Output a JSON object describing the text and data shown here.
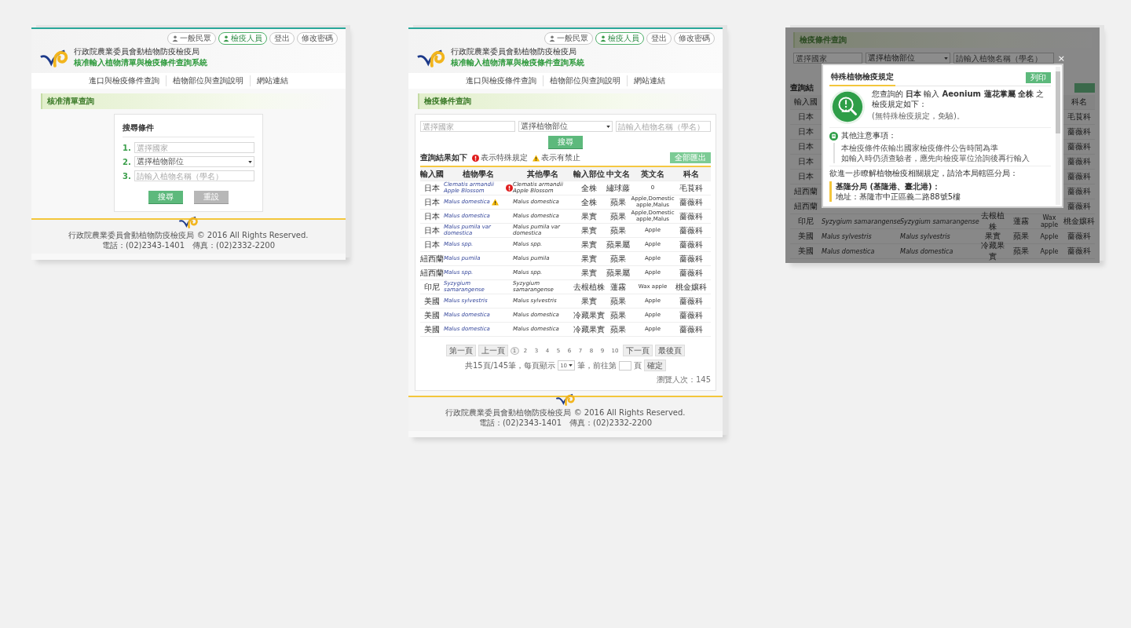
{
  "screens": [
    {
      "kind": "search",
      "header": {
        "top_links": [
          {
            "label": "一般民眾",
            "kind": "user",
            "selected": false
          },
          {
            "label": "檢疫人員",
            "kind": "user",
            "selected": true
          },
          {
            "label": "登出",
            "kind": "plain",
            "selected": false
          },
          {
            "label": "修改密碼",
            "kind": "plain",
            "selected": false
          }
        ],
        "org": "行政院農業委員會動植物防疫檢疫局",
        "system": "核准輸入植物清單與檢疫條件查詢系統"
      },
      "nav": [
        "進口與檢疫條件查詢",
        "植物部位與查詢說明",
        "網站連結"
      ],
      "heading": "核准清單查詢",
      "card_title": "搜尋條件",
      "fields": [
        {
          "number": "1.",
          "kind": "input",
          "placeholder": "選擇國家"
        },
        {
          "number": "2.",
          "kind": "select",
          "value": "選擇植物部位"
        },
        {
          "number": "3.",
          "kind": "input",
          "placeholder": "請輸入植物名稱（學名）"
        }
      ],
      "buttons": [
        {
          "label": "搜尋",
          "kind": "primary"
        },
        {
          "label": "重設",
          "kind": "secondary"
        }
      ],
      "footer": {
        "copyright": "行政院農業委員會動植物防疫檢疫局 © 2016 All Rights Reserved.",
        "contact": "電話：(02)2343-1401　傳真：(02)2332-2200"
      }
    },
    {
      "kind": "results",
      "header": {
        "top_links": [
          {
            "label": "一般民眾",
            "kind": "user",
            "selected": false
          },
          {
            "label": "檢疫人員",
            "kind": "user",
            "selected": true
          },
          {
            "label": "登出",
            "kind": "plain",
            "selected": false
          },
          {
            "label": "修改密碼",
            "kind": "plain",
            "selected": false
          }
        ],
        "org": "行政院農業委員會動植物防疫檢疫局",
        "system": "核准輸入植物清單與檢疫條件查詢系統"
      },
      "nav": [
        "進口與檢疫條件查詢",
        "植物部位與查詢說明",
        "網站連結"
      ],
      "heading": "檢疫條件查詢",
      "fields": [
        {
          "kind": "input",
          "placeholder": "選擇國家"
        },
        {
          "kind": "select",
          "value": "選擇植物部位"
        },
        {
          "kind": "input",
          "placeholder": "請輸入植物名稱（學名）"
        }
      ],
      "search_button": "搜尋",
      "results_title": "查詢結果如下",
      "legend": [
        {
          "kind": "special",
          "label": "表示特殊規定"
        },
        {
          "kind": "warning",
          "label": "表示有禁止"
        }
      ],
      "export_button": "全部匯出",
      "columns": [
        "輸入國",
        "植物學名",
        "其他學名",
        "輸入部位",
        "中文名",
        "英文名",
        "科名"
      ],
      "rows": [
        {
          "country": "日本",
          "scientific": "Clematis armandii Apple Blossom",
          "kind": "special",
          "other": "Clematis armandii Apple Blossom",
          "part": "全株",
          "chinese": "繡球藤",
          "english": "0",
          "family": "毛茛科"
        },
        {
          "country": "日本",
          "scientific": "Malus domestica",
          "kind": "warning",
          "other": "Malus domestica",
          "part": "全株",
          "chinese": "蘋果",
          "english": "Apple,Domestic apple,Malus",
          "family": "薔薇科"
        },
        {
          "country": "日本",
          "scientific": "Malus domestica",
          "kind": "plain",
          "other": "Malus domestica",
          "part": "果實",
          "chinese": "蘋果",
          "english": "Apple,Domestic apple,Malus",
          "family": "薔薇科"
        },
        {
          "country": "日本",
          "scientific": "Malus pumila var domestica",
          "kind": "plain",
          "other": "Malus pumila var domestica",
          "part": "果實",
          "chinese": "蘋果",
          "english": "Apple",
          "family": "薔薇科"
        },
        {
          "country": "日本",
          "scientific": "Malus spp.",
          "kind": "plain",
          "other": "Malus spp.",
          "part": "果實",
          "chinese": "蘋果屬",
          "english": "Apple",
          "family": "薔薇科"
        },
        {
          "country": "紐西蘭",
          "scientific": "Malus pumila",
          "kind": "plain",
          "other": "Malus pumila",
          "part": "果實",
          "chinese": "蘋果",
          "english": "Apple",
          "family": "薔薇科"
        },
        {
          "country": "紐西蘭",
          "scientific": "Malus spp.",
          "kind": "plain",
          "other": "Malus spp.",
          "part": "果實",
          "chinese": "蘋果屬",
          "english": "Apple",
          "family": "薔薇科"
        },
        {
          "country": "印尼",
          "scientific": "Syzygium samarangense",
          "kind": "plain",
          "other": "Syzygium samarangense",
          "part": "去根植株",
          "chinese": "蓮霧",
          "english": "Wax apple",
          "family": "桃金孃科"
        },
        {
          "country": "美國",
          "scientific": "Malus sylvestris",
          "kind": "plain",
          "other": "Malus sylvestris",
          "part": "果實",
          "chinese": "蘋果",
          "english": "Apple",
          "family": "薔薇科"
        },
        {
          "country": "美國",
          "scientific": "Malus domestica",
          "kind": "plain",
          "other": "Malus domestica",
          "part": "冷藏果實",
          "chinese": "蘋果",
          "english": "Apple",
          "family": "薔薇科"
        },
        {
          "country": "美國",
          "scientific": "Malus domestica",
          "kind": "plain",
          "other": "Malus domestica",
          "part": "冷藏果實",
          "chinese": "蘋果",
          "english": "Apple",
          "family": "薔薇科"
        }
      ],
      "pager": {
        "first": "第一頁",
        "prev": "上一頁",
        "pages": [
          {
            "label": "1",
            "selected": true
          },
          {
            "label": "2",
            "selected": false
          },
          {
            "label": "3",
            "selected": false
          },
          {
            "label": "4",
            "selected": false
          },
          {
            "label": "5",
            "selected": false
          },
          {
            "label": "6",
            "selected": false
          },
          {
            "label": "7",
            "selected": false
          },
          {
            "label": "8",
            "selected": false
          },
          {
            "label": "9",
            "selected": false
          },
          {
            "label": "10",
            "selected": false
          }
        ],
        "next": "下一頁",
        "last": "最後頁",
        "info_prefix": "共15頁/145筆，每頁顯示",
        "per_page": "10",
        "info_middle": "筆，前往第",
        "info_suffix": "頁",
        "go": "確定"
      },
      "visitors": "瀏覽人次：145",
      "footer": {
        "copyright": "行政院農業委員會動植物防疫檢疫局 © 2016 All Rights Reserved.",
        "contact": "電話：(02)2343-1401　傳真：(02)2332-2200"
      }
    },
    {
      "kind": "modal",
      "heading": "檢疫條件查詢",
      "fields": [
        {
          "kind": "input",
          "placeholder": "選擇國家"
        },
        {
          "kind": "select",
          "value": "選擇植物部位"
        },
        {
          "kind": "input",
          "placeholder": "請輸入植物名稱（學名）"
        }
      ],
      "results_title": "查詢結",
      "first_column": "輸入國",
      "last_column": "科名",
      "hidden_rows": [
        {
          "country": "日本",
          "family": "毛茛科"
        },
        {
          "country": "日本",
          "family": "薔薇科"
        },
        {
          "country": "日本",
          "family": "薔薇科"
        },
        {
          "country": "日本",
          "family": "薔薇科"
        },
        {
          "country": "日本",
          "family": "薔薇科"
        },
        {
          "country": "紐西蘭",
          "family": "薔薇科"
        },
        {
          "country": "紐西蘭",
          "family": "薔薇科"
        }
      ],
      "rows": [
        {
          "country": "印尼",
          "scientific": "Syzygium samarangense",
          "other": "Syzygium samarangense",
          "part": "去根植株",
          "chinese": "蓮霧",
          "english": "Wax apple",
          "family": "桃金孃科"
        },
        {
          "country": "美國",
          "scientific": "Malus sylvestris",
          "other": "Malus sylvestris",
          "part": "果實",
          "chinese": "蘋果",
          "english": "Apple",
          "family": "薔薇科"
        },
        {
          "country": "美國",
          "scientific": "Malus domestica",
          "other": "Malus domestica",
          "part": "冷藏果實",
          "chinese": "蘋果",
          "english": "Apple",
          "family": "薔薇科"
        }
      ],
      "modal": {
        "close": "×",
        "title": "特殊植物檢疫規定",
        "print": "列印",
        "intro": "您查詢的 **日本** 輸入 **Aeonium 蓮花掌屬 全株** 之檢疫規定如下：",
        "result": "(無特殊檢疫規定，免驗)。",
        "notes_title": "其他注意事項：",
        "notes": [
          "本檢疫條件依輸出國家檢疫條件公告時間為準",
          "如輸入時仍須查驗者，應先向檢疫單位洽詢後再行輸入"
        ],
        "contact_intro": "欲進一步瞭解植物檢疫相關規定，請洽本局轄區分局：",
        "branch": "基隆分局 (基隆港、臺北港)：",
        "address": "地址：基隆市中正區義二路88號5樓"
      }
    }
  ]
}
